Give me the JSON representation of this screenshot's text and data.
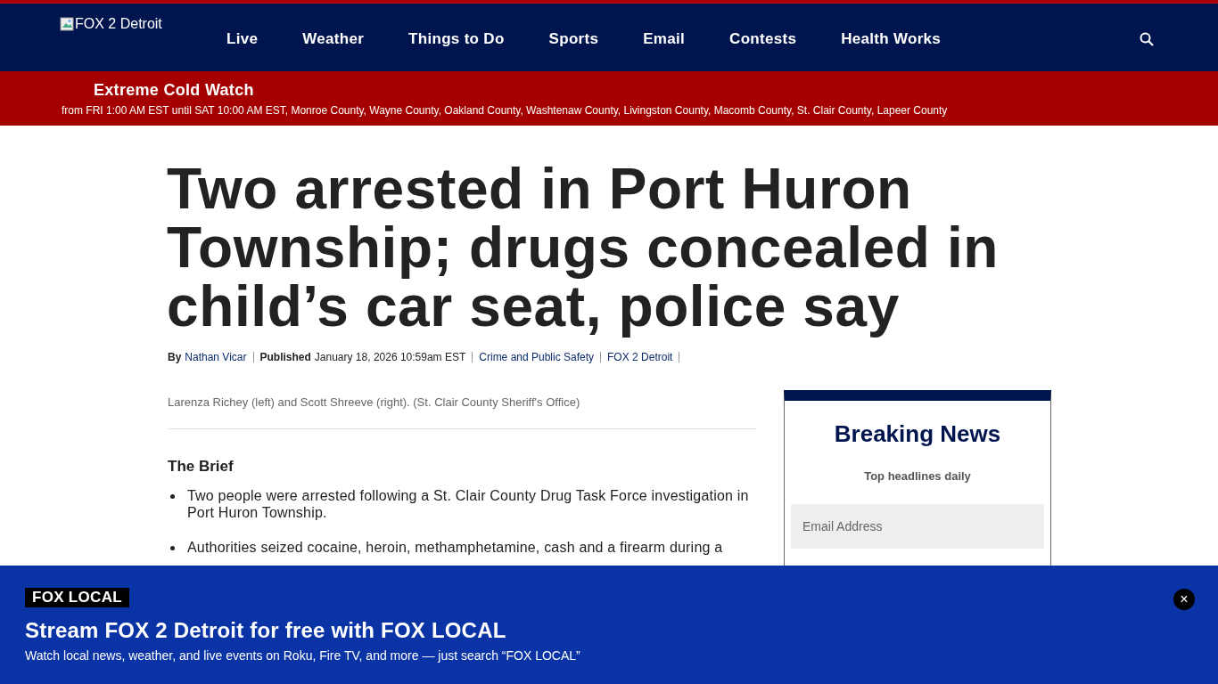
{
  "header": {
    "logo_alt": "FOX 2 Detroit",
    "nav": [
      "Live",
      "Weather",
      "Things to Do",
      "Sports",
      "Email",
      "Contests",
      "Health Works"
    ]
  },
  "alert": {
    "title": "Extreme Cold Watch",
    "details": "from FRI 1:00 AM EST until SAT 10:00 AM EST, Monroe County, Wayne County, Oakland County, Washtenaw County, Livingston County, Macomb County, St. Clair County, Lapeer County"
  },
  "article": {
    "headline": "Two arrested in Port Huron Township; drugs concealed in child’s car seat, police say",
    "byline": {
      "label": "By",
      "author": "Nathan Vicar"
    },
    "published": {
      "label": "Published",
      "date": "January 18, 2026 10:59am EST"
    },
    "tags": [
      "Crime and Public Safety",
      "FOX 2 Detroit"
    ],
    "caption": "Larenza Richey (left) and Scott Shreeve (right). (St. Clair County Sheriff's Office)",
    "brief_title": "The Brief",
    "brief": [
      "Two people were arrested following a St. Clair County Drug Task Force investigation in Port Huron Township.",
      "Authorities seized cocaine, heroin, methamphetamine, cash and a firearm during a"
    ]
  },
  "newsletter": {
    "title": "Breaking News",
    "subtitle": "Top headlines daily",
    "email_placeholder": "Email Address"
  },
  "banner": {
    "badge": "FOX LOCAL",
    "title": "Stream FOX 2 Detroit for free with FOX LOCAL",
    "text": "Watch local news, weather, and live events on Roku, Fire TV, and more — just search “FOX LOCAL”",
    "close": "×"
  }
}
